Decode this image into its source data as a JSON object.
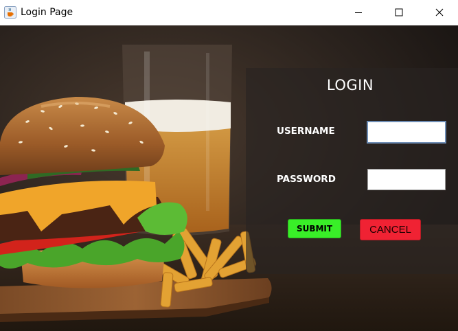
{
  "window": {
    "title": "Login Page",
    "app_icon": "java-cup-icon",
    "controls": {
      "minimize_icon": "minimize-icon",
      "maximize_icon": "maximize-icon",
      "close_icon": "close-icon"
    }
  },
  "background": {
    "description_icon": "burger-fries-beer-photo"
  },
  "login": {
    "title": "LOGIN",
    "username_label": "USERNAME",
    "username_value": "",
    "password_label": "PASSWORD",
    "password_value": "",
    "submit_label": "SUBMIT",
    "cancel_label": "CANCEL"
  },
  "colors": {
    "submit": "#39ef28",
    "cancel": "#f02233",
    "panel": "rgba(40,36,34,0.62)"
  }
}
